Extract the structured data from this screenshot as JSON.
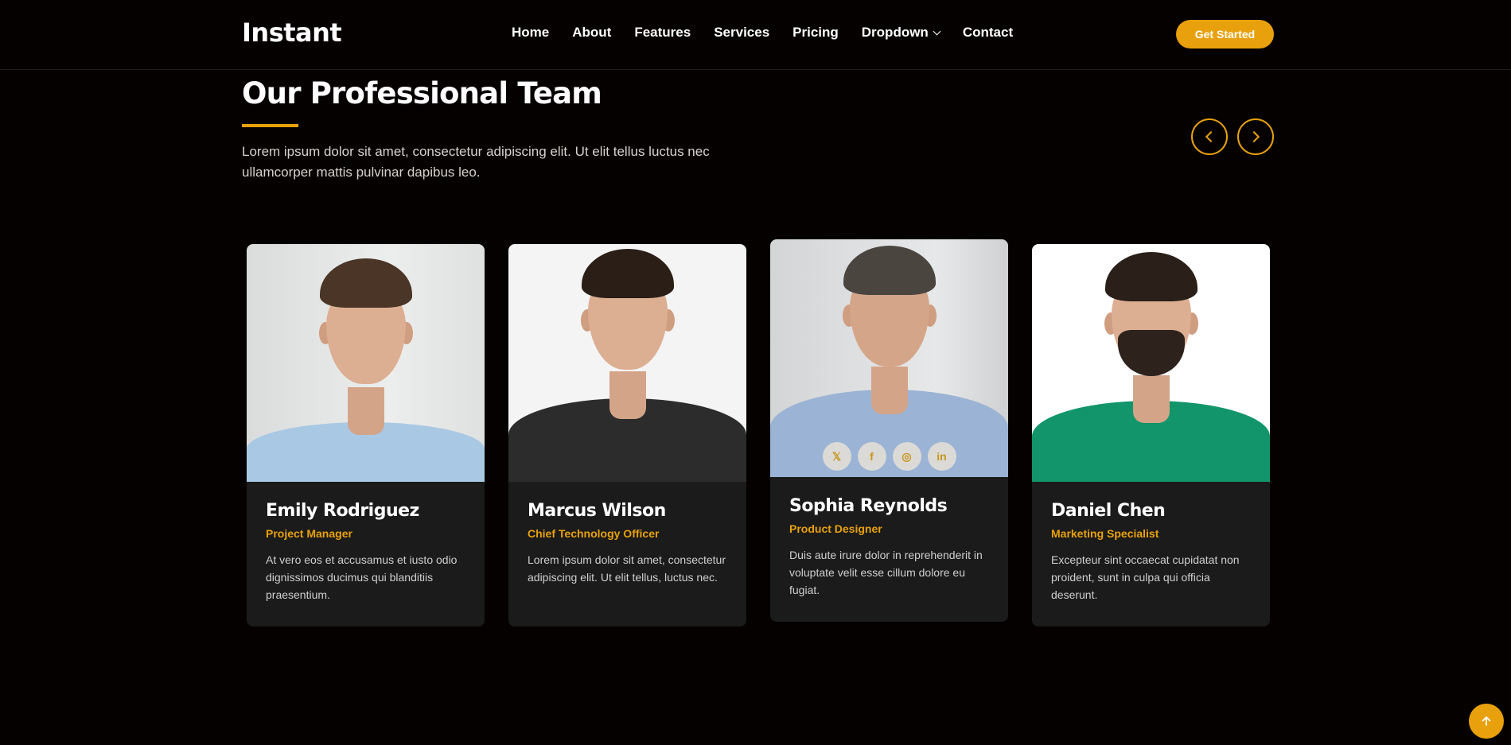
{
  "header": {
    "logo": "Instant",
    "nav": [
      {
        "label": "Home"
      },
      {
        "label": "About"
      },
      {
        "label": "Features"
      },
      {
        "label": "Services"
      },
      {
        "label": "Pricing"
      },
      {
        "label": "Dropdown",
        "has_dropdown": true
      },
      {
        "label": "Contact"
      }
    ],
    "cta_label": "Get Started"
  },
  "section": {
    "title": "Our Professional Team",
    "description": "Lorem ipsum dolor sit amet, consectetur adipiscing elit. Ut elit tellus luctus nec ullamcorper mattis pulvinar dapibus leo."
  },
  "team": [
    {
      "name": "Emily Rodriguez",
      "role": "Project Manager",
      "bio": "At vero eos et accusamus et iusto odio dignissimos ducimus qui blanditiis praesentium."
    },
    {
      "name": "Marcus Wilson",
      "role": "Chief Technology Officer",
      "bio": "Lorem ipsum dolor sit amet, consectetur adipiscing elit. Ut elit tellus, luctus nec."
    },
    {
      "name": "Sophia Reynolds",
      "role": "Product Designer",
      "bio": "Duis aute irure dolor in reprehenderit in voluptate velit esse cillum dolore eu fugiat."
    },
    {
      "name": "Daniel Chen",
      "role": "Marketing Specialist",
      "bio": "Excepteur sint occaecat cupidatat non proident, sunt in culpa qui officia deserunt."
    }
  ],
  "social_icons": [
    "x-icon",
    "facebook-icon",
    "instagram-icon",
    "linkedin-icon"
  ],
  "colors": {
    "accent": "#e8a10c",
    "background": "#050100",
    "card": "#1b1b1b"
  }
}
